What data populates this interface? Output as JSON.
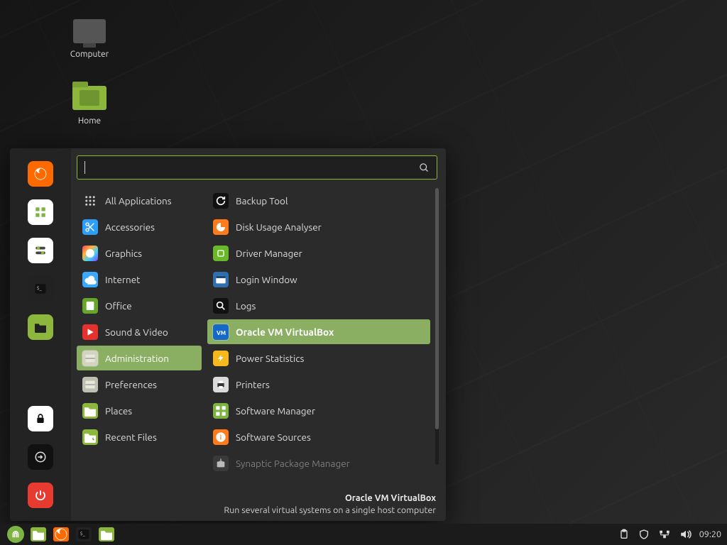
{
  "desktop": {
    "icons": [
      {
        "id": "computer",
        "label": "Computer"
      },
      {
        "id": "home",
        "label": "Home"
      }
    ]
  },
  "menu": {
    "search_placeholder": "",
    "favorites": [
      {
        "id": "firefox",
        "icon": "firefox-icon",
        "bg": "#ff6a00"
      },
      {
        "id": "apps",
        "icon": "grid-icon",
        "bg": "#ffffff",
        "fg": "#7cb342"
      },
      {
        "id": "settings",
        "icon": "toggles-icon",
        "bg": "#ffffff"
      },
      {
        "id": "terminal",
        "icon": "terminal-icon",
        "bg": "#222"
      },
      {
        "id": "files",
        "icon": "folder-icon",
        "bg": "#8db63c"
      },
      {
        "id": "lock",
        "icon": "lock-icon",
        "bg": "#ffffff"
      },
      {
        "id": "logout",
        "icon": "logout-icon",
        "bg": "#111"
      },
      {
        "id": "power",
        "icon": "power-icon",
        "bg": "#e63b2e"
      }
    ],
    "categories": [
      {
        "label": "All Applications",
        "icon": "grid-dots-icon",
        "bg": "transparent",
        "fg": "#cfcfcf"
      },
      {
        "label": "Accessories",
        "icon": "scissors-icon",
        "bg": "#2e9df7"
      },
      {
        "label": "Graphics",
        "icon": "palette-icon",
        "bg": "linear-gradient(135deg,#ff3b6b,#ffb23b,#3bd1ff,#8f3bff)"
      },
      {
        "label": "Internet",
        "icon": "cloud-icon",
        "bg": "#3aa8ff"
      },
      {
        "label": "Office",
        "icon": "book-icon",
        "bg": "#6aa52b"
      },
      {
        "label": "Sound & Video",
        "icon": "play-icon",
        "bg": "#e5322e"
      },
      {
        "label": "Administration",
        "icon": "drawer-icon",
        "bg": "#d3d3c2",
        "selected": true
      },
      {
        "label": "Preferences",
        "icon": "drawer-icon",
        "bg": "#bfbfb2"
      },
      {
        "label": "Places",
        "icon": "folder-icon",
        "bg": "#8db63c"
      },
      {
        "label": "Recent Files",
        "icon": "folder-clock-icon",
        "bg": "#8db63c"
      }
    ],
    "apps": [
      {
        "label": "Backup Tool",
        "icon": "refresh-icon",
        "bg": "#111"
      },
      {
        "label": "Disk Usage Analyser",
        "icon": "pie-icon",
        "bg": "#ff7a1a"
      },
      {
        "label": "Driver Manager",
        "icon": "chip-icon",
        "bg": "#6ab72a"
      },
      {
        "label": "Login Window",
        "icon": "window-icon",
        "bg": "#2f6fb0"
      },
      {
        "label": "Logs",
        "icon": "magnify-icon",
        "bg": "#111"
      },
      {
        "label": "Oracle VM VirtualBox",
        "icon": "vbox-icon",
        "bg": "#1468c7",
        "selected": true
      },
      {
        "label": "Power Statistics",
        "icon": "bolt-icon",
        "bg": "#f5b81f"
      },
      {
        "label": "Printers",
        "icon": "printer-icon",
        "bg": "#dadada",
        "fg": "#333"
      },
      {
        "label": "Software Manager",
        "icon": "grid-icon",
        "bg": "#7cb342"
      },
      {
        "label": "Software Sources",
        "icon": "info-icon",
        "bg": "#ff7a1a"
      },
      {
        "label": "Synaptic Package Manager",
        "icon": "box-down-icon",
        "bg": "#3a3a3a",
        "dim": true
      }
    ],
    "tooltip": {
      "title": "Oracle VM VirtualBox",
      "desc": "Run several virtual systems on a single host computer"
    }
  },
  "panel": {
    "launchers": [
      {
        "id": "menu",
        "icon": "mint-icon"
      },
      {
        "id": "files",
        "icon": "folder-icon",
        "bg": "#8db63c"
      },
      {
        "id": "firefox",
        "icon": "firefox-icon",
        "bg": "#ff6a00"
      },
      {
        "id": "terminal",
        "icon": "terminal-icon",
        "bg": "#222"
      },
      {
        "id": "files2",
        "icon": "folder-icon",
        "bg": "#8db63c"
      }
    ],
    "tray": [
      {
        "id": "clipboard",
        "icon": "clipboard-icon"
      },
      {
        "id": "shield",
        "icon": "shield-icon"
      },
      {
        "id": "network",
        "icon": "network-icon"
      },
      {
        "id": "volume",
        "icon": "volume-icon"
      }
    ],
    "clock": "09:20"
  },
  "colors": {
    "accent": "#8db63c"
  }
}
